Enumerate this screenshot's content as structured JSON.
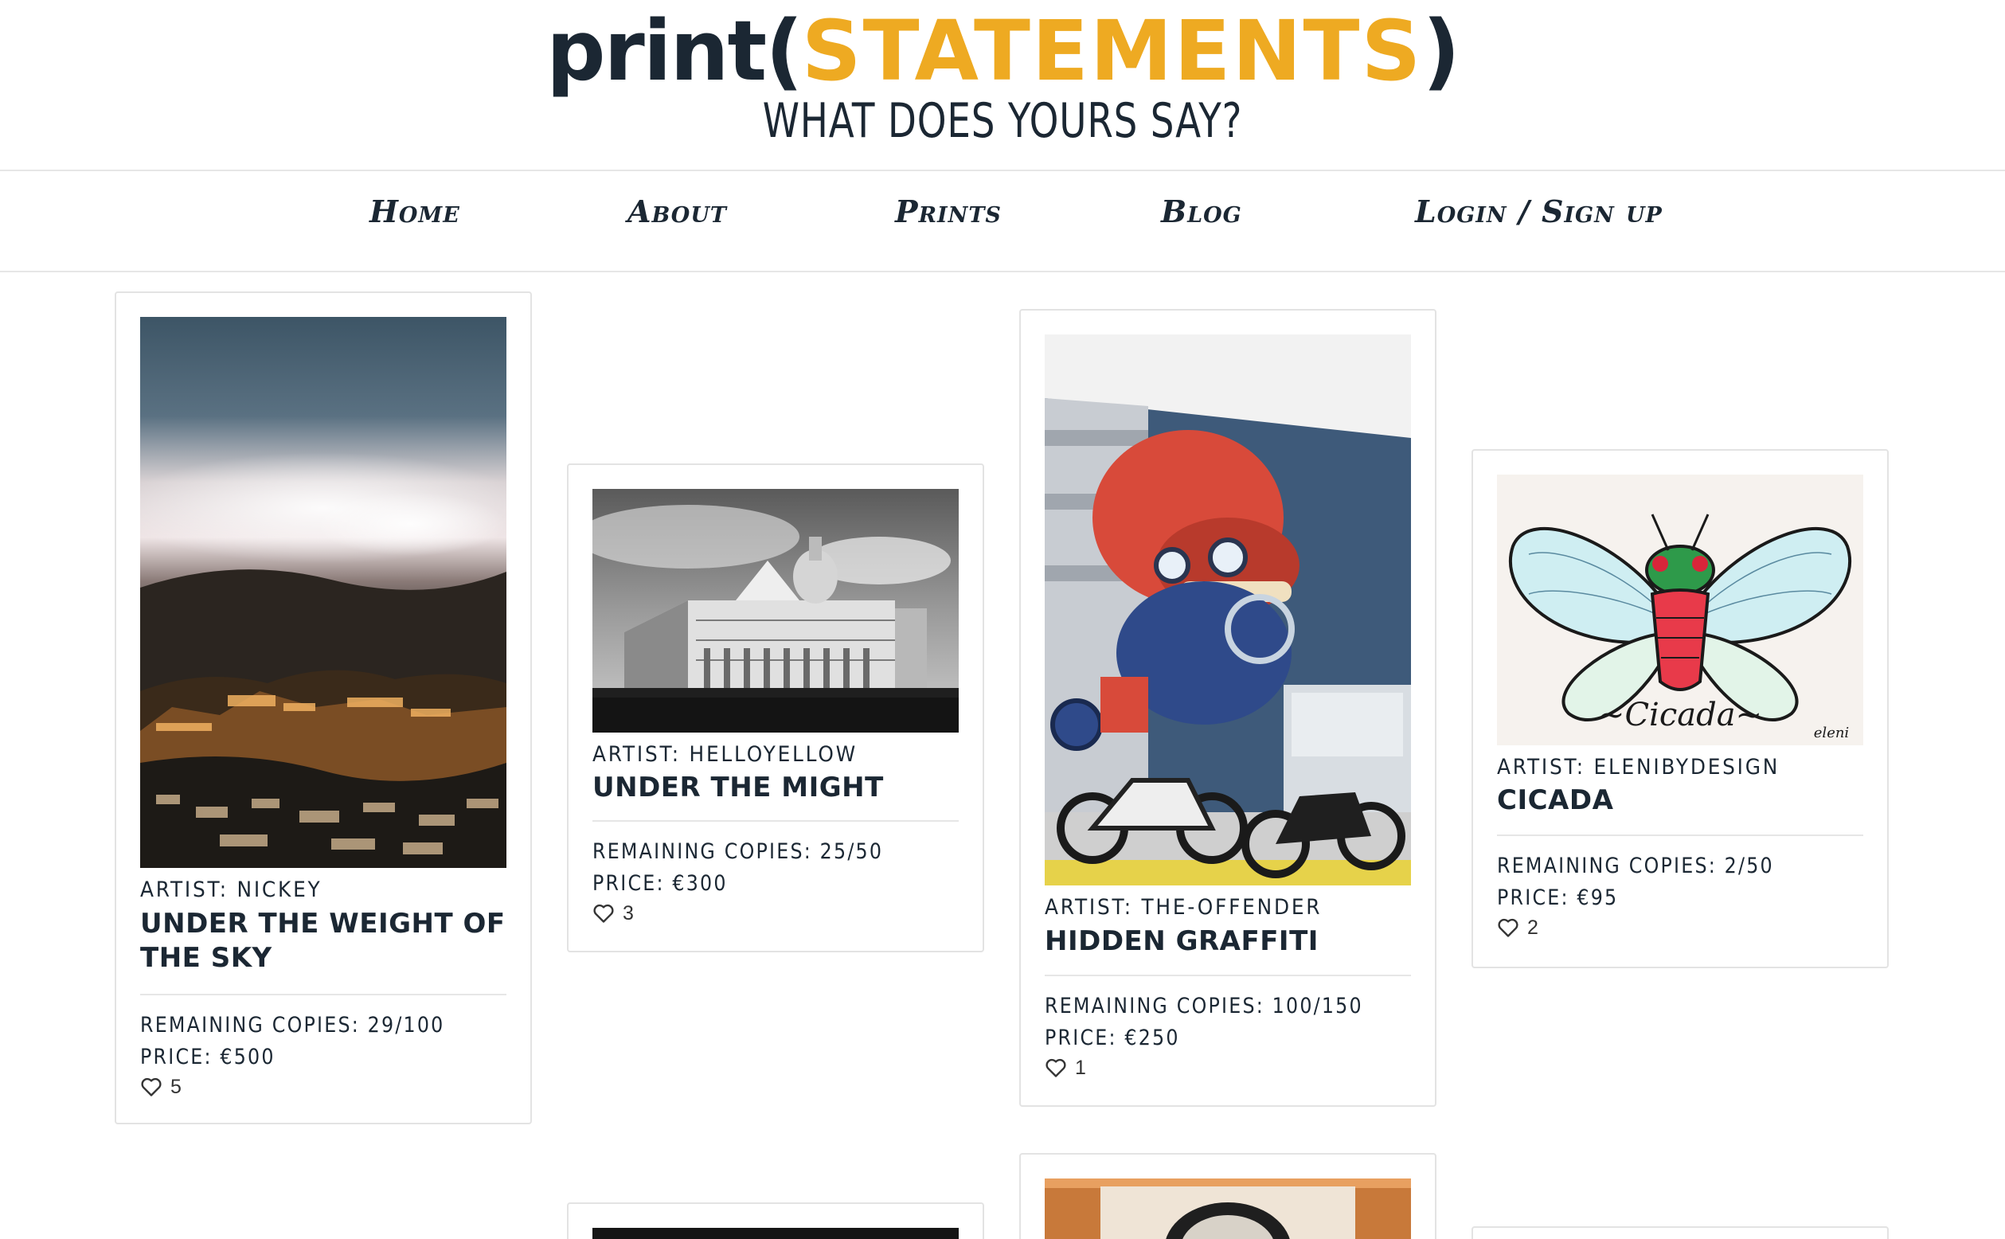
{
  "header": {
    "logo_prefix": "print(",
    "logo_accent": "STATEMENTS",
    "logo_suffix": ")",
    "tagline": "WHAT DOES YOURS SAY?",
    "colors": {
      "dark": "#1b2733",
      "accent": "#eeaa22"
    }
  },
  "nav": {
    "home": "Home",
    "about": "About",
    "prints": "Prints",
    "blog": "Blog",
    "login": "Login / Sign up"
  },
  "prints": [
    {
      "artist": "ARTIST: NICKEY",
      "title": "UNDER THE WEIGHT OF THE SKY",
      "remaining": "REMAINING COPIES: 29/100",
      "price": "PRICE: €500",
      "likes": "5",
      "image": "city-under-clouds-photo"
    },
    {
      "artist": "ARTIST: HELLOYELLOW",
      "title": "UNDER THE MIGHT",
      "remaining": "REMAINING COPIES: 25/50",
      "price": "PRICE: €300",
      "likes": "3",
      "image": "cathedral-black-white-photo"
    },
    {
      "artist": "ARTIST: THE-OFFENDER",
      "title": "HIDDEN GRAFFITI",
      "remaining": "REMAINING COPIES: 100/150",
      "price": "PRICE: €250",
      "likes": "1",
      "image": "robot-frog-mural-photo"
    },
    {
      "artist": "ARTIST: ELENIBYDESIGN",
      "title": "CICADA",
      "remaining": "REMAINING COPIES: 2/50",
      "price": "PRICE: €95",
      "likes": "2",
      "image": "cicada-illustration",
      "image_text": "~Cicada~",
      "signature": "eleni"
    }
  ]
}
